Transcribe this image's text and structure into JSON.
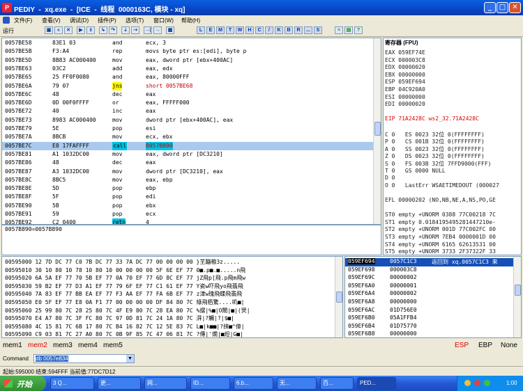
{
  "window": {
    "title": "PEDIY  -  xq.exe  -  [ICE  -  线程  0000163C, 模块 - xq]"
  },
  "menu": [
    "文件(F)",
    "查看(V)",
    "调试(D)",
    "插件(P)",
    "选项(T)",
    "窗口(W)",
    "帮助(H)"
  ],
  "toolbar": {
    "run_label": "运行",
    "letter_buttons": [
      "L",
      "E",
      "M",
      "T",
      "W",
      "H",
      "C",
      "/",
      "K",
      "B",
      "R",
      "...",
      "S"
    ]
  },
  "disasm": [
    {
      "addr": "0057BE58",
      "hex": "83E1 03",
      "mn": "and",
      "ops": "ecx, 3"
    },
    {
      "addr": "0057BE5B",
      "hex": "F3:A4",
      "mn": "rep",
      "ops": "movs byte ptr es:[edi], byte p"
    },
    {
      "addr": "0057BE5D",
      "hex": "8B83 AC000400",
      "mn": "mov",
      "ops": "eax, dword ptr [ebx+400AC]"
    },
    {
      "addr": "0057BE63",
      "hex": "03C2",
      "mn": "add",
      "ops": "eax, edx"
    },
    {
      "addr": "0057BE65",
      "hex": "25 FF0F0080",
      "mn": "and",
      "ops": "eax, 80000FFF"
    },
    {
      "addr": "0057BE6A",
      "hex": "79 07",
      "mn": "jns",
      "ops": "short 0057BE68"
    },
    {
      "addr": "0057BE6C",
      "hex": "48",
      "mn": "dec",
      "ops": "eax"
    },
    {
      "addr": "0057BE6D",
      "hex": "0D 00F0FFFF",
      "mn": "or",
      "ops": "eax, FFFFF000"
    },
    {
      "addr": "0057BE72",
      "hex": "40",
      "mn": "inc",
      "ops": "eax"
    },
    {
      "addr": "0057BE73",
      "hex": "8983 AC000400",
      "mn": "mov",
      "ops": "dword ptr [ebx+400AC], eax"
    },
    {
      "addr": "0057BE79",
      "hex": "5E",
      "mn": "pop",
      "ops": "esi"
    },
    {
      "addr": "0057BE7A",
      "hex": "8BCB",
      "mn": "mov",
      "ops": "ecx, ebx"
    },
    {
      "addr": "0057BE7C",
      "hex": "E8 17FAFFFF",
      "mn": "call",
      "ops": "0057B890"
    },
    {
      "addr": "0057BE81",
      "hex": "A1 1032DC00",
      "mn": "mov",
      "ops": "eax, dword ptr [DC3210]"
    },
    {
      "addr": "0057BE86",
      "hex": "48",
      "mn": "dec",
      "ops": "eax"
    },
    {
      "addr": "0057BE87",
      "hex": "A3 1032DC00",
      "mn": "mov",
      "ops": "dword ptr [DC3210], eax"
    },
    {
      "addr": "0057BE8C",
      "hex": "8BC5",
      "mn": "mov",
      "ops": "eax, ebp"
    },
    {
      "addr": "0057BE8E",
      "hex": "5D",
      "mn": "pop",
      "ops": "ebp"
    },
    {
      "addr": "0057BE8F",
      "hex": "5F",
      "mn": "pop",
      "ops": "edi"
    },
    {
      "addr": "0057BE90",
      "hex": "5B",
      "mn": "pop",
      "ops": "ebx"
    },
    {
      "addr": "0057BE91",
      "hex": "59",
      "mn": "pop",
      "ops": "ecx"
    },
    {
      "addr": "0057BE92",
      "hex": "C2 0400",
      "mn": "retn",
      "ops": "4"
    },
    {
      "addr": "0057BE95",
      "hex": "90",
      "mn": "nop",
      "ops": ""
    }
  ],
  "info_text": "0057B890=0057B890",
  "registers": {
    "header": "寄存器 (FPU)",
    "rows": [
      "EAX 059EF74E",
      "ECX 000003C8",
      "EDX 00000020",
      "EBX 00000000",
      "ESP 059EF694",
      "EBP 04C920A0",
      "ESI 00000000",
      "EDI 00000020",
      "",
      "EIP 71A2428C ws2_32.71A2428C",
      "",
      "C 0   ES 0023 32位 0(FFFFFFFF)",
      "P 0   CS 001B 32位 0(FFFFFFFF)",
      "A 0   SS 0023 32位 0(FFFFFFFF)",
      "Z 0   DS 0023 32位 0(FFFFFFFF)",
      "S 0   FS 003B 32位 7FFD9000(FFF)",
      "T 0   GS 0000 NULL",
      "D 0",
      "O 0   LastErr WSAETIMEDOUT (000027",
      "",
      "EFL 00000202 (NO,NB,NE,A,NS,PO,GE",
      "",
      "ST0 empty +UNORM 0388 77C00218 7C",
      "ST1 empty 0.0184195495281447210e-",
      "ST2 empty +UNORM 001D 77C002FC 00",
      "ST3 empty +UNORM 7EB4 0000001D 00",
      "ST4 empty +UNORM 6165 62613531 00",
      "ST5 empty +UNORM 3733 2F37322F 33"
    ],
    "eip_value": "71A2428C"
  },
  "hexdump": [
    "00595000 12 7D DC 77 C0 7B DC 77 33 7A DC 77 00 00 00 00 }芏蹦粮3z.....",
    "00595010 30 10 80 10 78 10 80 10 00 00 00 00 5F 6E EF 77 0■.p■.■.....n飛",
    "00595020 6A 5A EF 77 70 5B EF 77 0A 70 EF 77 6D 8C EF 77 jZ飛p[飛.p飛m飛w",
    "00595030 59 B2 EF 77 D3 A1 EF 77 79 6F EF 77 C1 61 EF 77 Y瓷w吓飛yo飛翡飛",
    "00595040 7A 83 EF 77 BB EA EF 77 F3 AA EF 77 FA 6B EF 77 z津w瑰飛蝶飛翡飛",
    "00595050 E0 5F EF 77 E8 0A F1 77 00 00 00 00 DF 84 80 7C 綠飛栢驚....叽■|",
    "00595060 25 99 80 7C 28 25 80 7C 4F E9 80 7C 28 EA 80 7C %摆|%■|O閘|■|(焸|",
    "00595070 E4 A7 80 7C 3F FC 80 7C 97 0D 81 7C 24 1A 80 7C 湃|?觸|?|$■|",
    "00595080 4C 15 81 7C 6B 17 80 7C B4 16 82 7C 12 5E 83 7C L■|k■■|?抹■^傽|",
    "00595090 C9 03 81 7C 27 A0 80 7C 0B 9F 85 7C 47 06 81 7C ?傳|'燗|■炟|G■|"
  ],
  "stack": [
    {
      "addr": "059EF694",
      "val": "0057C1C3",
      "cmt": "返回到 xq.0057C1C3 来"
    },
    {
      "addr": "059EF698",
      "val": "000003C8",
      "cmt": ""
    },
    {
      "addr": "059EF69C",
      "val": "00000002",
      "cmt": ""
    },
    {
      "addr": "059EF6A0",
      "val": "00000001",
      "cmt": ""
    },
    {
      "addr": "059EF6A4",
      "val": "00000002",
      "cmt": ""
    },
    {
      "addr": "059EF6A8",
      "val": "00000000",
      "cmt": ""
    },
    {
      "addr": "059EF6AC",
      "val": "01D756E0",
      "cmt": ""
    },
    {
      "addr": "059EF6B0",
      "val": "05A1FFB4",
      "cmt": ""
    },
    {
      "addr": "059EF6B4",
      "val": "01D75770",
      "cmt": ""
    },
    {
      "addr": "059EF6B8",
      "val": "00000000",
      "cmt": ""
    }
  ],
  "memtabs": {
    "tabs": [
      "mem1",
      "mem2",
      "mem3",
      "mem4",
      "mem5"
    ],
    "active": "mem2",
    "right": [
      "ESP",
      "EBP",
      "None"
    ]
  },
  "command": {
    "label": "Command",
    "value": "db 0057e834"
  },
  "status": "起始:595000 结束:594FFF 当前值:77DC7D12",
  "taskbar": {
    "start": "开始",
    "tasks": [
      "3 Q...",
      "更...",
      "网...",
      "ID...",
      "6.b...",
      "无...",
      "百...",
      "PED..."
    ],
    "clock": "1:00"
  },
  "colors": {
    "title_blue": "#0a5fe0",
    "selection": "#a9c9ee",
    "call_highlight": "#00c0e0",
    "jns_highlight": "#fff800",
    "stack_selected": "#1550b8"
  }
}
